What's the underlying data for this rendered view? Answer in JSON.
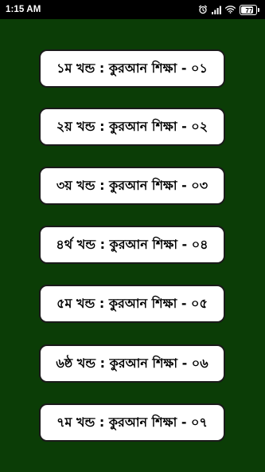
{
  "status_bar": {
    "time": "1:15 AM",
    "battery_level": "77",
    "icons": [
      "alarm-icon",
      "signal-icon",
      "wifi-icon",
      "battery-icon"
    ]
  },
  "theme": {
    "background": "#0b3d06",
    "button_bg": "#ffffff",
    "button_border": "#1a1a1a",
    "text": "#000000"
  },
  "lessons": [
    {
      "label": "১ম খন্ড : কুরআন শিক্ষা - ০১"
    },
    {
      "label": "২য় খন্ড : কুরআন শিক্ষা - ০২"
    },
    {
      "label": "৩য় খন্ড : কুরআন শিক্ষা - ০৩"
    },
    {
      "label": "৪র্থ খন্ড : কুরআন শিক্ষা - ০৪"
    },
    {
      "label": "৫ম খন্ড : কুরআন শিক্ষা - ০৫"
    },
    {
      "label": "৬ষ্ঠ খন্ড : কুরআন শিক্ষা - ০৬"
    },
    {
      "label": "৭ম খন্ড : কুরআন শিক্ষা - ০৭"
    }
  ]
}
